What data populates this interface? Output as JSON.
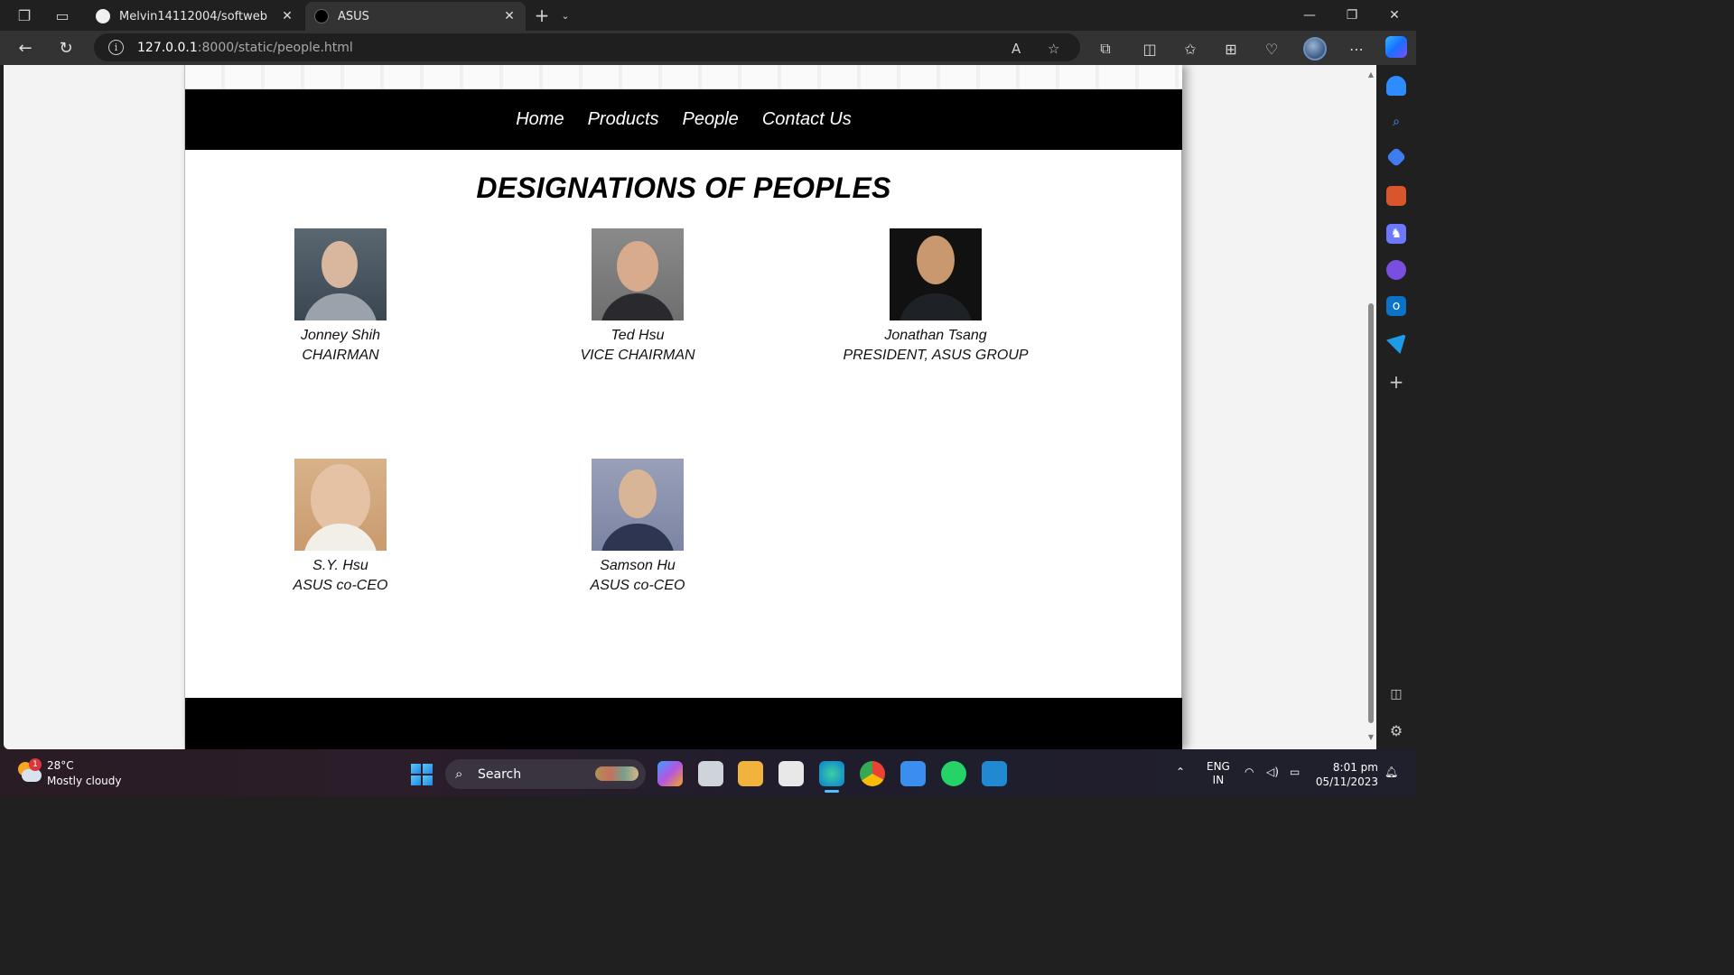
{
  "browser": {
    "tabs": [
      {
        "title": "Melvin14112004/softweb",
        "active": false
      },
      {
        "title": "ASUS",
        "active": true
      }
    ],
    "address": {
      "host": "127.0.0.1",
      "rest": ":8000/static/people.html"
    }
  },
  "site": {
    "nav": [
      "Home",
      "Products",
      "People",
      "Contact Us"
    ],
    "heading": "DESIGNATIONS OF PEOPLES",
    "people": [
      {
        "name": "Jonney Shih",
        "title": "CHAIRMAN"
      },
      {
        "name": "Ted Hsu",
        "title": "VICE CHAIRMAN"
      },
      {
        "name": "Jonathan Tsang",
        "title": "PRESIDENT, ASUS GROUP"
      },
      {
        "name": "S.Y. Hsu",
        "title": "ASUS co-CEO"
      },
      {
        "name": "Samson Hu",
        "title": "ASUS co-CEO"
      }
    ]
  },
  "taskbar": {
    "weather": {
      "temp": "28°C",
      "desc": "Mostly cloudy",
      "badge": "1"
    },
    "search_label": "Search",
    "lang": {
      "line1": "ENG",
      "line2": "IN"
    },
    "clock": {
      "time": "8:01 pm",
      "date": "05/11/2023"
    }
  }
}
